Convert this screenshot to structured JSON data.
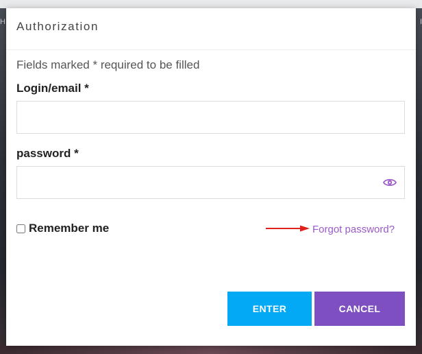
{
  "background": {
    "left_edge_text": "H",
    "right_edge_text": "I"
  },
  "modal": {
    "title": "Authorization",
    "required_note": "Fields marked * required to be filled",
    "login": {
      "label": "Login/email *",
      "value": "",
      "placeholder": ""
    },
    "password": {
      "label": "password *",
      "value": "",
      "placeholder": "",
      "toggle_icon": "eye-icon"
    },
    "remember_me": {
      "label": "Remember me",
      "checked": false
    },
    "annotation_arrow": {
      "icon": "arrow-right-icon",
      "color": "#e0201a"
    },
    "forgot_password": {
      "text": "Forgot password?",
      "color": "#9b59c9"
    },
    "buttons": {
      "enter": "ENTER",
      "cancel": "CANCEL"
    },
    "colors": {
      "enter_bg": "#03a9f4",
      "cancel_bg": "#7e4fc0"
    }
  }
}
